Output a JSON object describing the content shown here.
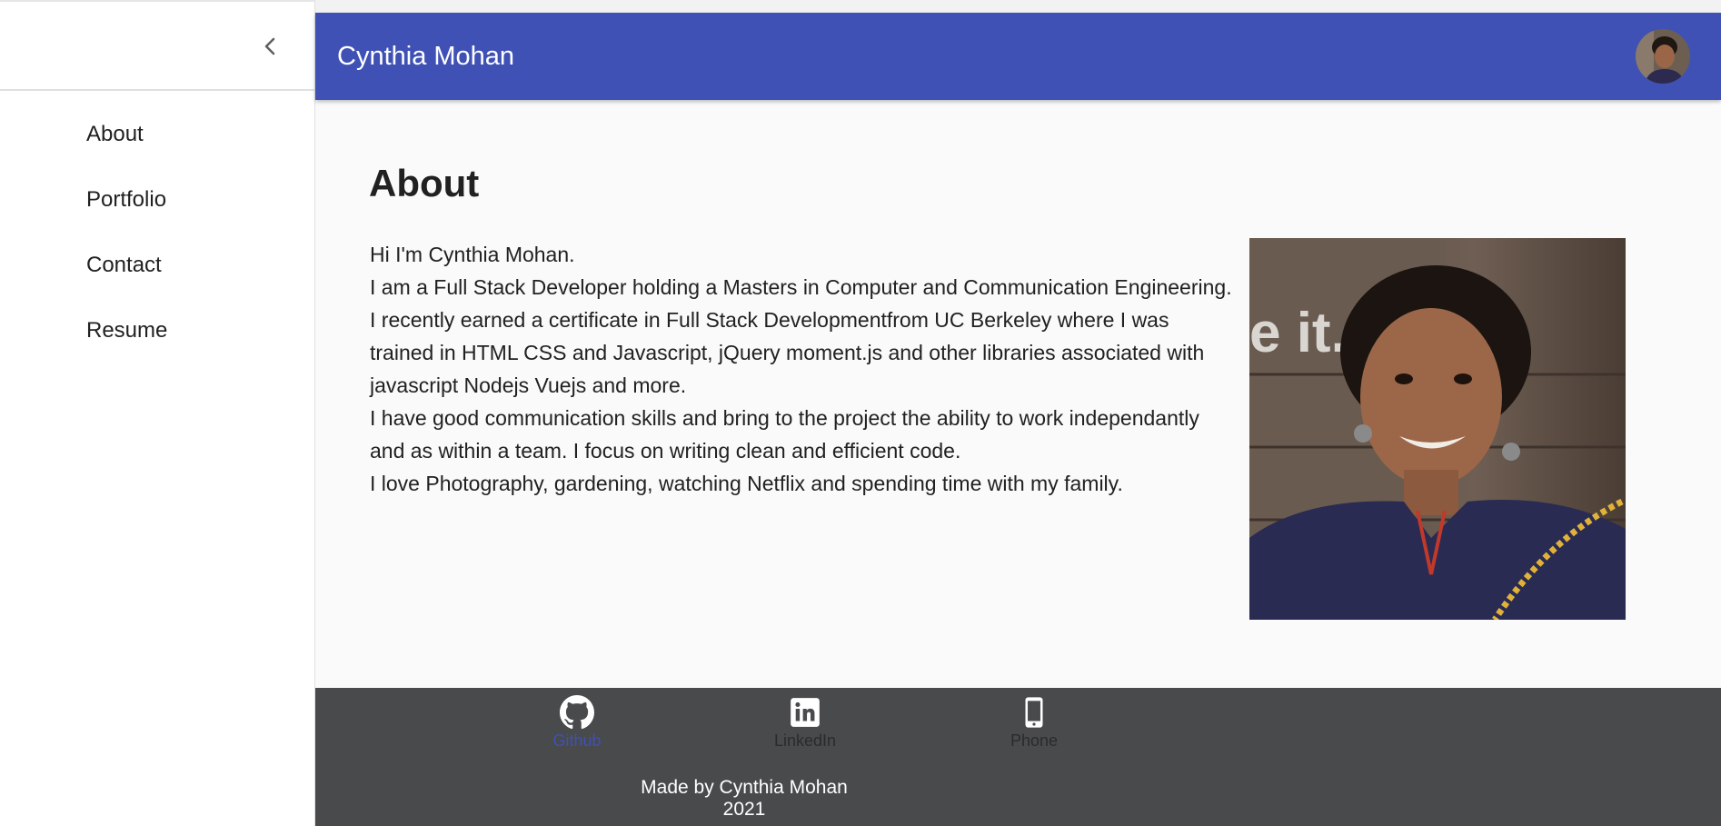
{
  "app": {
    "title": "Cynthia Mohan"
  },
  "sidebar": {
    "items": [
      {
        "label": "About"
      },
      {
        "label": "Portfolio"
      },
      {
        "label": "Contact"
      },
      {
        "label": "Resume"
      }
    ]
  },
  "main": {
    "heading": "About",
    "paragraphs": [
      "Hi I'm Cynthia Mohan.",
      "I am a Full Stack Developer holding a Masters in Computer and Communication Engineering.",
      "I recently earned a certificate in Full Stack Developmentfrom UC Berkeley where I was trained in HTML CSS and Javascript, jQuery moment.js and other libraries associated with javascript Nodejs Vuejs and more.",
      "I have good communication skills and bring to the project the ability to work independantly and as within a team. I focus on writing clean and efficient code.",
      "I love Photography, gardening, watching Netflix and spending time with my family."
    ]
  },
  "footer": {
    "links": [
      {
        "label": "Github",
        "icon": "github-icon",
        "color": "#3f51b5"
      },
      {
        "label": "LinkedIn",
        "icon": "linkedin-icon",
        "color": "#2b2b2b"
      },
      {
        "label": "Phone",
        "icon": "phone-icon",
        "color": "#2b2b2b"
      }
    ],
    "made_by": "Made by Cynthia Mohan 2021"
  },
  "colors": {
    "primary": "#3f51b5",
    "footer_bg": "#484a4c",
    "background": "#fafafa"
  }
}
